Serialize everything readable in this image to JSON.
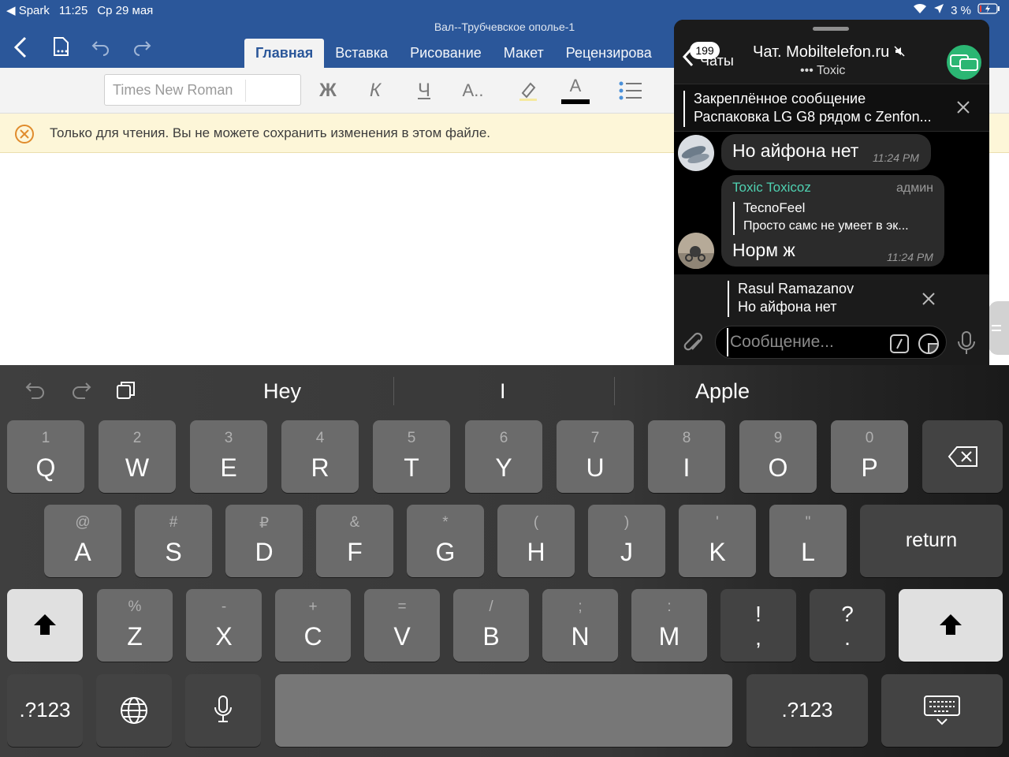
{
  "status_bar": {
    "back_app": "◀ Spark",
    "time": "11:25",
    "date": "Ср 29 мая",
    "battery": "3 %"
  },
  "word": {
    "doc_title": "Вал--Трубчевское ополье-1",
    "tabs": [
      {
        "label": "Главная",
        "active": true
      },
      {
        "label": "Вставка"
      },
      {
        "label": "Рисование"
      },
      {
        "label": "Макет"
      },
      {
        "label": "Рецензирова"
      }
    ],
    "font_name": "Times New Roman",
    "format_buttons": {
      "bold": "Ж",
      "italic": "К",
      "underline": "Ч",
      "font_size": "A..",
      "font_color": "A"
    },
    "readonly_message": "Только для чтения. Вы не можете сохранить изменения в этом файле.",
    "accent_color": "#2b579a"
  },
  "telegram": {
    "unread_badge": "199",
    "chats_label": "Чаты",
    "chat_title": "Чат. Mobiltelefon.ru",
    "chat_subtitle": "••• Toxic",
    "pinned_label": "Закреплённое сообщение",
    "pinned_text": "Распаковка LG G8 рядом с Zenfon...",
    "messages": [
      {
        "text": "Но айфона нет",
        "time": "11:24 PM"
      },
      {
        "sender": "Toxic Toxicoz",
        "role": "админ",
        "quote_author": "TecnoFeel",
        "quote_text": "Просто самс не умеет в эк...",
        "text": "Норм ж",
        "time": "11:24 PM"
      }
    ],
    "reply_to": {
      "name": "Rasul Ramazanov",
      "text": "Но айфона нет"
    },
    "input_placeholder": "Сообщение..."
  },
  "keyboard": {
    "suggestions": [
      "Hey",
      "I",
      "Apple"
    ],
    "row1": [
      [
        "1",
        "Q"
      ],
      [
        "2",
        "W"
      ],
      [
        "3",
        "E"
      ],
      [
        "4",
        "R"
      ],
      [
        "5",
        "T"
      ],
      [
        "6",
        "Y"
      ],
      [
        "7",
        "U"
      ],
      [
        "8",
        "I"
      ],
      [
        "9",
        "O"
      ],
      [
        "0",
        "P"
      ]
    ],
    "row2": [
      [
        "@",
        "A"
      ],
      [
        "#",
        "S"
      ],
      [
        "₽",
        "D"
      ],
      [
        "&",
        "F"
      ],
      [
        "*",
        "G"
      ],
      [
        "(",
        "H"
      ],
      [
        ")",
        "J"
      ],
      [
        "'",
        "K"
      ],
      [
        "\"",
        "L"
      ]
    ],
    "row3": [
      [
        "%",
        "Z"
      ],
      [
        "-",
        "X"
      ],
      [
        "+",
        "C"
      ],
      [
        "=",
        "V"
      ],
      [
        "/",
        "B"
      ],
      [
        ";",
        "N"
      ],
      [
        ":",
        "M"
      ],
      [
        "!",
        ","
      ],
      [
        "?",
        "."
      ]
    ],
    "return_label": "return",
    "numbers_label": ".?123"
  }
}
